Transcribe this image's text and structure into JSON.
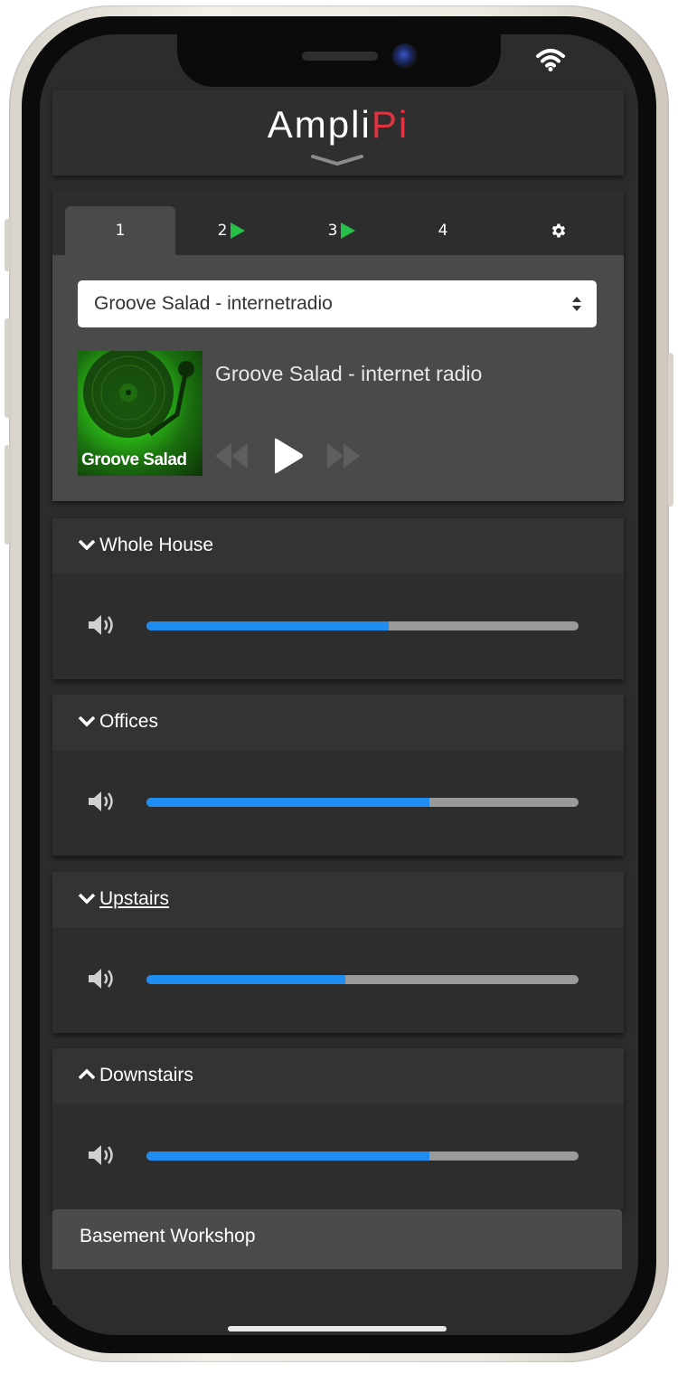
{
  "app": {
    "logo_main": "Ampli",
    "logo_accent": "Pi",
    "colors": {
      "accent_red": "#e0323f",
      "slider_blue": "#1e8cf0",
      "playing_green": "#27c049"
    }
  },
  "source_tabs": [
    {
      "label": "1",
      "active": true,
      "playing": false
    },
    {
      "label": "2",
      "active": false,
      "playing": true
    },
    {
      "label": "3",
      "active": false,
      "playing": true
    },
    {
      "label": "4",
      "active": false,
      "playing": false
    },
    {
      "label": "",
      "icon": "gear-icon"
    }
  ],
  "player": {
    "selected_stream": "Groove Salad - internetradio",
    "album_art_label": "Groove Salad",
    "track_title": "Groove Salad - internet radio",
    "controls": [
      "rewind-icon",
      "play-icon",
      "fast-forward-icon"
    ]
  },
  "zones": [
    {
      "name": "Whole House",
      "expanded": true,
      "volume": 0.56
    },
    {
      "name": "Offices",
      "expanded": true,
      "volume": 0.655
    },
    {
      "name": "Upstairs",
      "expanded": true,
      "volume": 0.46
    },
    {
      "name": "Downstairs",
      "expanded": false,
      "volume": 0.655
    }
  ],
  "basement": {
    "label": "Basement Workshop"
  }
}
